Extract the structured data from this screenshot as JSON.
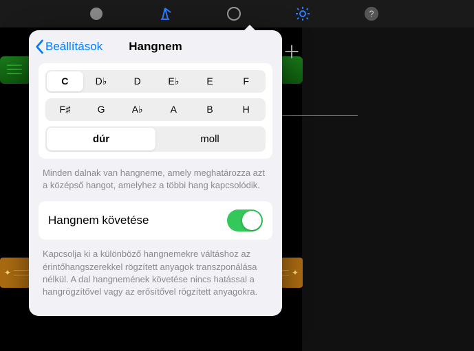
{
  "toolbar": {
    "icons": [
      "slider",
      "metronome",
      "loop",
      "gear",
      "help"
    ]
  },
  "popover": {
    "back_label": "Beállítások",
    "title": "Hangnem",
    "keys_row1": [
      "C",
      "D♭",
      "D",
      "E♭",
      "E",
      "F"
    ],
    "keys_row2": [
      "F♯",
      "G",
      "A♭",
      "A",
      "B",
      "H"
    ],
    "selected_key": "C",
    "modes": {
      "major": "dúr",
      "minor": "moll"
    },
    "selected_mode": "major",
    "desc1": "Minden dalnak van hangneme, amely meghatározza azt a középső hangot, amelyhez a többi hang kapcsolódik.",
    "follow_label": "Hangnem követése",
    "follow_on": true,
    "desc2": "Kapcsolja ki a különböző hangnemekre váltáshoz az érintőhangszerekkel rögzített anyagok transzponálása nélkül. A dal hangnemének követése nincs hatással a hangrögzítővel vagy az erősítővel rögzített anyagokra."
  }
}
